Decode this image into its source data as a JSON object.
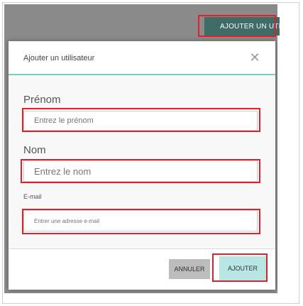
{
  "header": {
    "add_user_button": "AJOUTER UN UTI"
  },
  "dialog": {
    "title": "Ajouter un utilisateur",
    "close_icon": "close-icon",
    "fields": {
      "first_name": {
        "label": "Prénom",
        "placeholder": "Entrez le prénom"
      },
      "last_name": {
        "label": "Nom",
        "placeholder": "Entrez le nom"
      },
      "email": {
        "label": "E-mail",
        "placeholder": "Entrer une adresse e-mail"
      }
    },
    "footer": {
      "cancel_label": "ANNULER",
      "add_label": "AJOUTER"
    }
  },
  "colors": {
    "highlight": "#e0212d",
    "accent_teal": "#7ecbcb",
    "add_button_bg": "#b8e6e2",
    "top_button_bg": "#3f6b66"
  }
}
